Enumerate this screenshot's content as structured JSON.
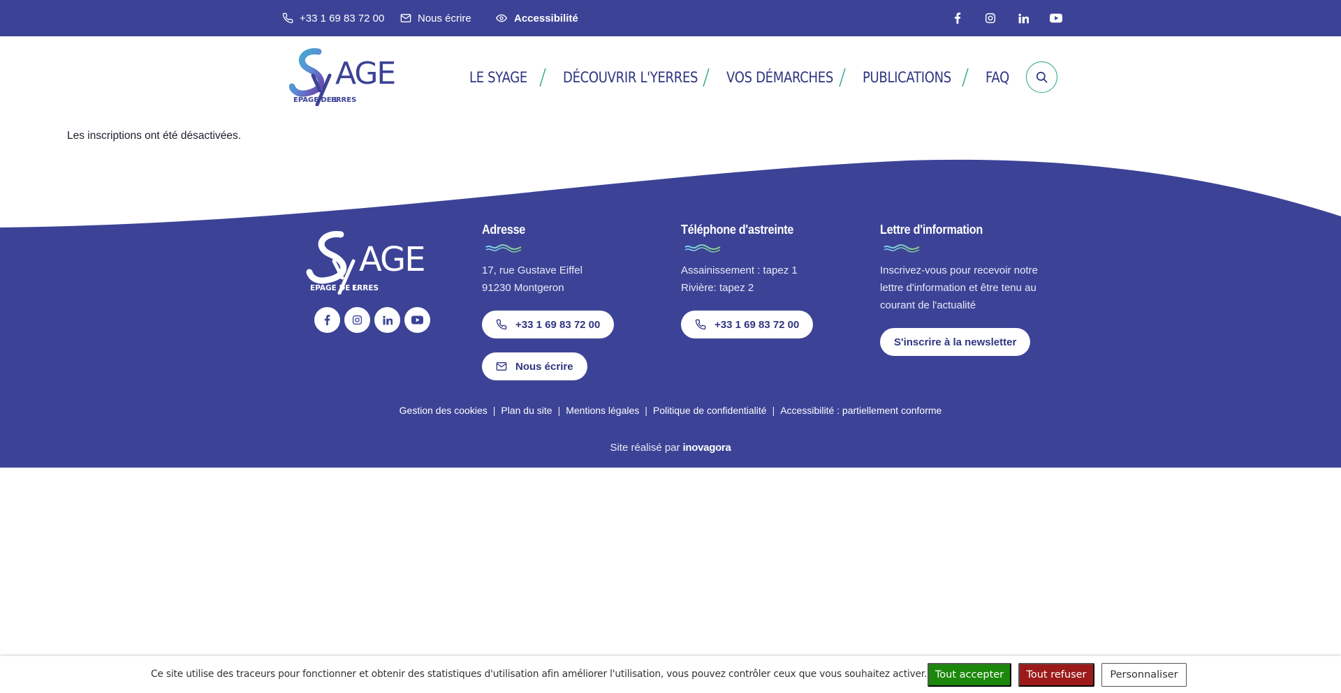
{
  "topbar": {
    "phone": "+33 1 69 83 72 00",
    "write": "Nous écrire",
    "accessibility": "Accessibilité",
    "social": [
      "facebook-icon",
      "instagram-icon",
      "linkedin-icon",
      "youtube-icon"
    ]
  },
  "header": {
    "logo": {
      "main": "SyAGE",
      "sub": "EPAGE DE L'YERRES"
    },
    "nav": [
      "LE SYAGE",
      "DÉCOUVRIR L'YERRES",
      "VOS DÉMARCHES",
      "PUBLICATIONS",
      "FAQ"
    ],
    "search_icon": "search-icon"
  },
  "main": {
    "message": "Les inscriptions ont été désactivées."
  },
  "footer": {
    "logo": {
      "main": "SyAGE",
      "sub": "EPAGE DE L'YERRES"
    },
    "address": {
      "title": "Adresse",
      "line1": "17, rue Gustave Eiffel",
      "line2": "91230 Montgeron",
      "phone_button": "+33 1 69 83 72 00",
      "write_button": "Nous écrire"
    },
    "emergency": {
      "title": "Téléphone d'astreinte",
      "line1": "Assainissement : tapez 1",
      "line2": "Rivière: tapez 2",
      "phone_button": "+33 1 69 83 72 00"
    },
    "newsletter": {
      "title": "Lettre d'information",
      "line1": "Inscrivez-vous pour recevoir notre",
      "line2": "lettre d'information et être tenu au",
      "line3": "courant de l'actualité",
      "button": "S'inscrire à la newsletter"
    },
    "legal": [
      "Gestion des cookies",
      "Plan du site",
      "Mentions légales",
      "Politique de confidentialité",
      "Accessibilité : partiellement conforme"
    ],
    "credit_prefix": "Site réalisé par",
    "credit_brand": "inovagora"
  },
  "cookies": {
    "text": "Ce site utilise des traceurs pour fonctionner et obtenir des statistiques d'utilisation afin améliorer l'utilisation, vous pouvez contrôler ceux que vous souhaitez activer.",
    "accept": "Tout accepter",
    "deny": "Tout refuser",
    "customize": "Personnaliser"
  },
  "colors": {
    "brand_blue": "#3c4396",
    "nav_text": "#2f3580",
    "teal": "#2aa68c",
    "accept": "#1b870b",
    "deny": "#9c1a1a"
  }
}
